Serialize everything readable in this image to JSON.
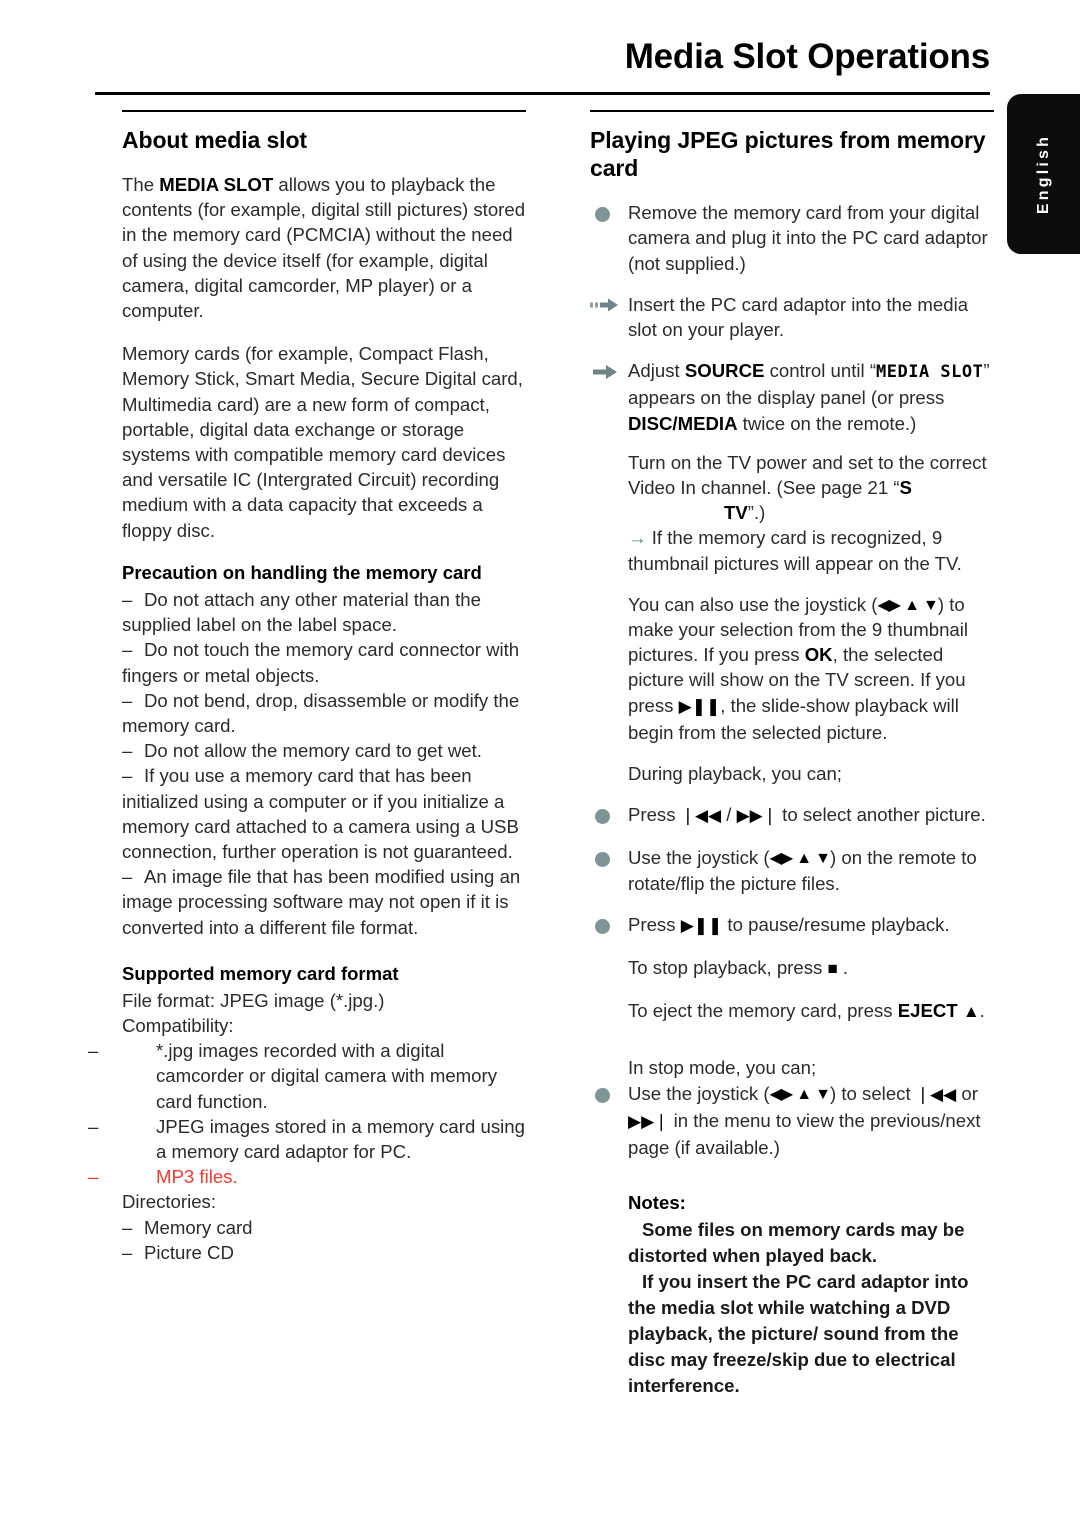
{
  "page": {
    "title": "Media Slot Operations",
    "language_tab": "English"
  },
  "left_column": {
    "heading": "About media slot",
    "para_1_pre": "The ",
    "para_1_bold": "MEDIA SLOT",
    "para_1_post": " allows you to playback the contents (for example, digital still pictures) stored in the memory card (PCMCIA) without the need of using the device itself (for example, digital camera, digital camcorder, MP player) or a computer.",
    "para_2": "Memory cards (for example, Compact Flash, Memory Stick, Smart Media, Secure Digital card, Multimedia card) are a new form of compact, portable, digital data exchange or storage systems with compatible memory card devices and versatile IC (Intergrated Circuit) recording medium with a data capacity that exceeds a floppy disc.",
    "precaution_heading": "Precaution on handling the memory card",
    "precaution_items": [
      "Do not attach any other material than the supplied label on the label space.",
      "Do not touch the memory card connector with fingers or metal objects.",
      "Do not bend, drop, disassemble or modify the memory card.",
      "Do not allow the memory card to get wet.",
      "If you use a memory card that has been initialized using a computer or if you initialize a memory card attached to a camera using a USB connection, further operation is not guaranteed.",
      "An image file that has been modified using an image processing software may not open if it is converted into a different file format."
    ],
    "supported_heading": "Supported memory card format",
    "file_format_line": "File format: JPEG image (*.jpg.)",
    "compatibility_label": "Compatibility:",
    "compatibility_items": [
      {
        "text": "*.jpg images recorded with a digital camcorder or digital camera with memory card function.",
        "color": "black"
      },
      {
        "text": "JPEG images stored in a memory card using a memory card adaptor for PC.",
        "color": "black"
      },
      {
        "text": "MP3 files.",
        "color": "red"
      }
    ],
    "directories_label": "Directories:",
    "directories_items": [
      "Memory card",
      "Picture CD"
    ]
  },
  "right_column": {
    "heading": "Playing JPEG pictures from memory card",
    "step_1": "Remove the memory card from your digital camera and plug it into the PC card adaptor (not supplied.)",
    "step_2": "Insert the PC card adaptor into the media slot on your player.",
    "step_3_pre": "Adjust ",
    "step_3_bold_1": "SOURCE",
    "step_3_mid": " control until “",
    "step_3_lcd": "MEDIA SLOT",
    "step_3_after_lcd": "” appears on the display panel (or press ",
    "step_3_bold_2": "DISC/MEDIA",
    "step_3_post": " twice on the remote.)",
    "tv_setup_line_1": "Turn on the TV power and set to the correct",
    "tv_setup_line_2_pre": "Video In channel.  (See page 21 “",
    "tv_setup_bold_s": "S",
    "tv_setup_bold_tv": "TV",
    "tv_setup_line_2_post": "”.)",
    "recognized_note": "If the memory card is recognized, 9 thumbnail pictures will appear on the TV.",
    "joystick_para_pre": "You can also use the joystick (",
    "joystick_para_mid1": ") to make your selection from the 9 thumbnail pictures.  If you press ",
    "joystick_bold_ok": "OK",
    "joystick_para_mid2": ", the selected picture will show on the TV screen.  If you press ",
    "joystick_para_post": ", the slide-show playback will begin from the selected picture.",
    "during_playback_label": "During playback, you can;",
    "playback_item_1_pre": "Press ",
    "playback_item_1_post": " to select another picture.",
    "playback_item_2_pre": "Use the joystick (",
    "playback_item_2_post": ") on the remote to rotate/flip the picture files.",
    "playback_item_3_pre": "Press ",
    "playback_item_3_post": " to pause/resume playback.",
    "stop_line_pre": "To stop playback, press ",
    "stop_line_post": ".",
    "eject_line_pre": "To eject the memory card, press ",
    "eject_line_bold": "EJECT",
    "eject_line_post": ".",
    "stop_mode_label": "In stop mode, you can;",
    "stop_mode_item_pre": "Use the joystick (",
    "stop_mode_item_mid": ") to select ",
    "stop_mode_item_or": " or ",
    "stop_mode_item_post": " in the menu to view the previous/next page (if available.)",
    "notes_heading": "Notes:",
    "note_1": "Some files on memory cards may be distorted when played back.",
    "note_2": "If you insert the PC card adaptor into the media slot while watching a DVD playback, the picture/ sound from the disc may freeze/skip due to electrical interference."
  },
  "glyphs": {
    "left_triangle": "◀",
    "right_triangle": "▶",
    "up_triangle": "▲",
    "down_triangle": "▼",
    "prev_track": "|◀◀",
    "next_track": "▶▶|",
    "play": "▶",
    "pause": "❙❙",
    "stop": "■",
    "eject": "▲",
    "arrow_right": "→"
  },
  "colors": {
    "bullet": "#7f9595",
    "arrow": "#6f8585",
    "red_text": "#ee3b33",
    "tab_background": "#0d0d0d",
    "text": "#2b2b2b"
  }
}
